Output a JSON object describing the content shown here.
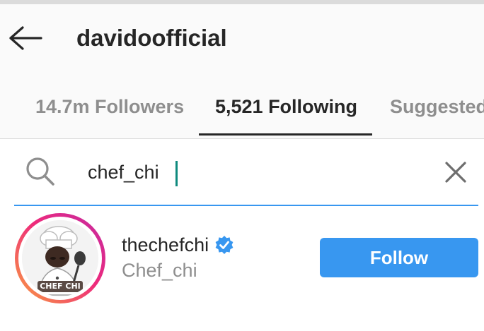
{
  "header": {
    "title": "davidoofficial",
    "back_icon": "arrow-left-icon"
  },
  "tabs": [
    {
      "label": "14.7m Followers",
      "active": false
    },
    {
      "label": "5,521 Following",
      "active": true
    },
    {
      "label": "Suggested",
      "active": false
    }
  ],
  "search": {
    "value": "chef_chi",
    "placeholder": "",
    "search_icon": "search-icon",
    "clear_icon": "close-icon"
  },
  "results": [
    {
      "username": "thechefchi",
      "full_name": "Chef_chi",
      "verified": true,
      "has_story_ring": true,
      "avatar_text": "CHEF CHI",
      "follow_label": "Follow"
    }
  ],
  "colors": {
    "accent": "#3897f0",
    "text_primary": "#262626",
    "text_secondary": "#8e8e8e",
    "caret": "#0f8a7e",
    "header_bg": "#fafafa"
  }
}
